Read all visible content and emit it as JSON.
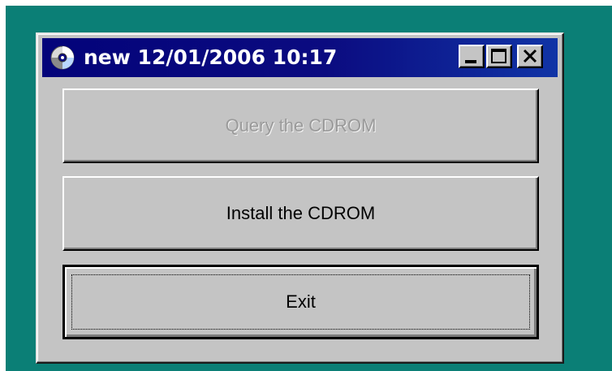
{
  "window": {
    "title": "new 12/01/2006 10:17",
    "icon": "cd-icon",
    "controls": {
      "minimize": "minimize-icon",
      "maximize": "maximize-icon",
      "close": "close-icon"
    }
  },
  "buttons": {
    "query": {
      "label": "Query the CDROM",
      "enabled": false
    },
    "install": {
      "label": "Install the CDROM",
      "enabled": true
    },
    "exit": {
      "label": "Exit",
      "enabled": true,
      "focused": true
    }
  },
  "colors": {
    "desktop": "#0b7f76",
    "titlebar_start": "#03037a",
    "titlebar_end": "#1034a6",
    "face": "#c4c4c4",
    "disabled_text": "#9a9a9a"
  }
}
